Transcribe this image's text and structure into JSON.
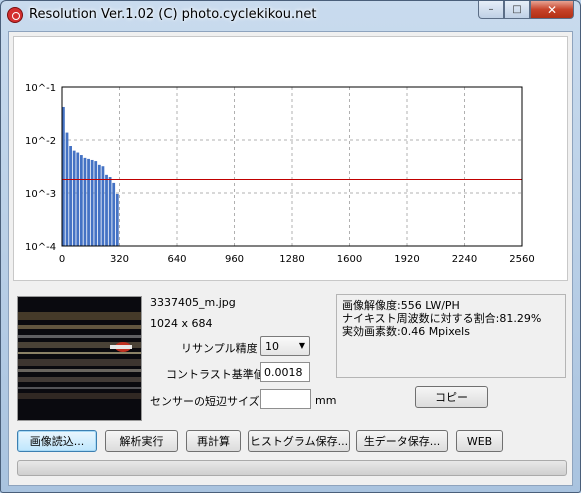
{
  "window": {
    "title": "Resolution Ver.1.02 (C) photo.cyclekikou.net",
    "controls": {
      "minimize": "–",
      "maximize": "□",
      "close": "✕"
    }
  },
  "chart_data": {
    "type": "bar",
    "y_scale": "log",
    "ylim": [
      0.0001,
      0.1
    ],
    "xlim": [
      0,
      2560
    ],
    "y_tick_labels": [
      "10^-1",
      "10^-2",
      "10^-3",
      "10^-4"
    ],
    "y_tick_values": [
      0.1,
      0.01,
      0.001,
      0.0001
    ],
    "x_tick_labels": [
      "0",
      "320",
      "640",
      "960",
      "1280",
      "1600",
      "1920",
      "2240",
      "2560"
    ],
    "x_tick_values": [
      0,
      320,
      640,
      960,
      1280,
      1600,
      1920,
      2240,
      2560
    ],
    "bar_width": 20,
    "bars_x": [
      10,
      30,
      50,
      70,
      90,
      110,
      130,
      150,
      170,
      190,
      210,
      230,
      250,
      270,
      290,
      310
    ],
    "bars_y": [
      0.042,
      0.0138,
      0.0077,
      0.0063,
      0.0058,
      0.0052,
      0.0046,
      0.0044,
      0.0042,
      0.004,
      0.0034,
      0.0032,
      0.0022,
      0.002,
      0.00155,
      0.00096
    ],
    "threshold": 0.0018,
    "grid": true,
    "bar_color": "#4472c4",
    "threshold_color": "#c00000"
  },
  "file": {
    "name": "3337405_m.jpg",
    "size": "1024 x 684"
  },
  "settings": {
    "resample_label": "リサンプル精度",
    "resample_value": "10",
    "contrast_label": "コントラスト基準値",
    "contrast_value": "0.0018",
    "sensor_label": "センサーの短辺サイズ",
    "sensor_value": "",
    "sensor_unit": "mm"
  },
  "results": {
    "line1": "画像解像度:556 LW/PH",
    "line2": "ナイキスト周波数に対する割合:81.29%",
    "line3": "実効画素数:0.46 Mpixels"
  },
  "buttons": {
    "copy": "コピー",
    "load": "画像読込...",
    "analyze": "解析実行",
    "recalc": "再計算",
    "save_hist": "ヒストグラム保存...",
    "save_raw": "生データ保存...",
    "web": "WEB"
  }
}
